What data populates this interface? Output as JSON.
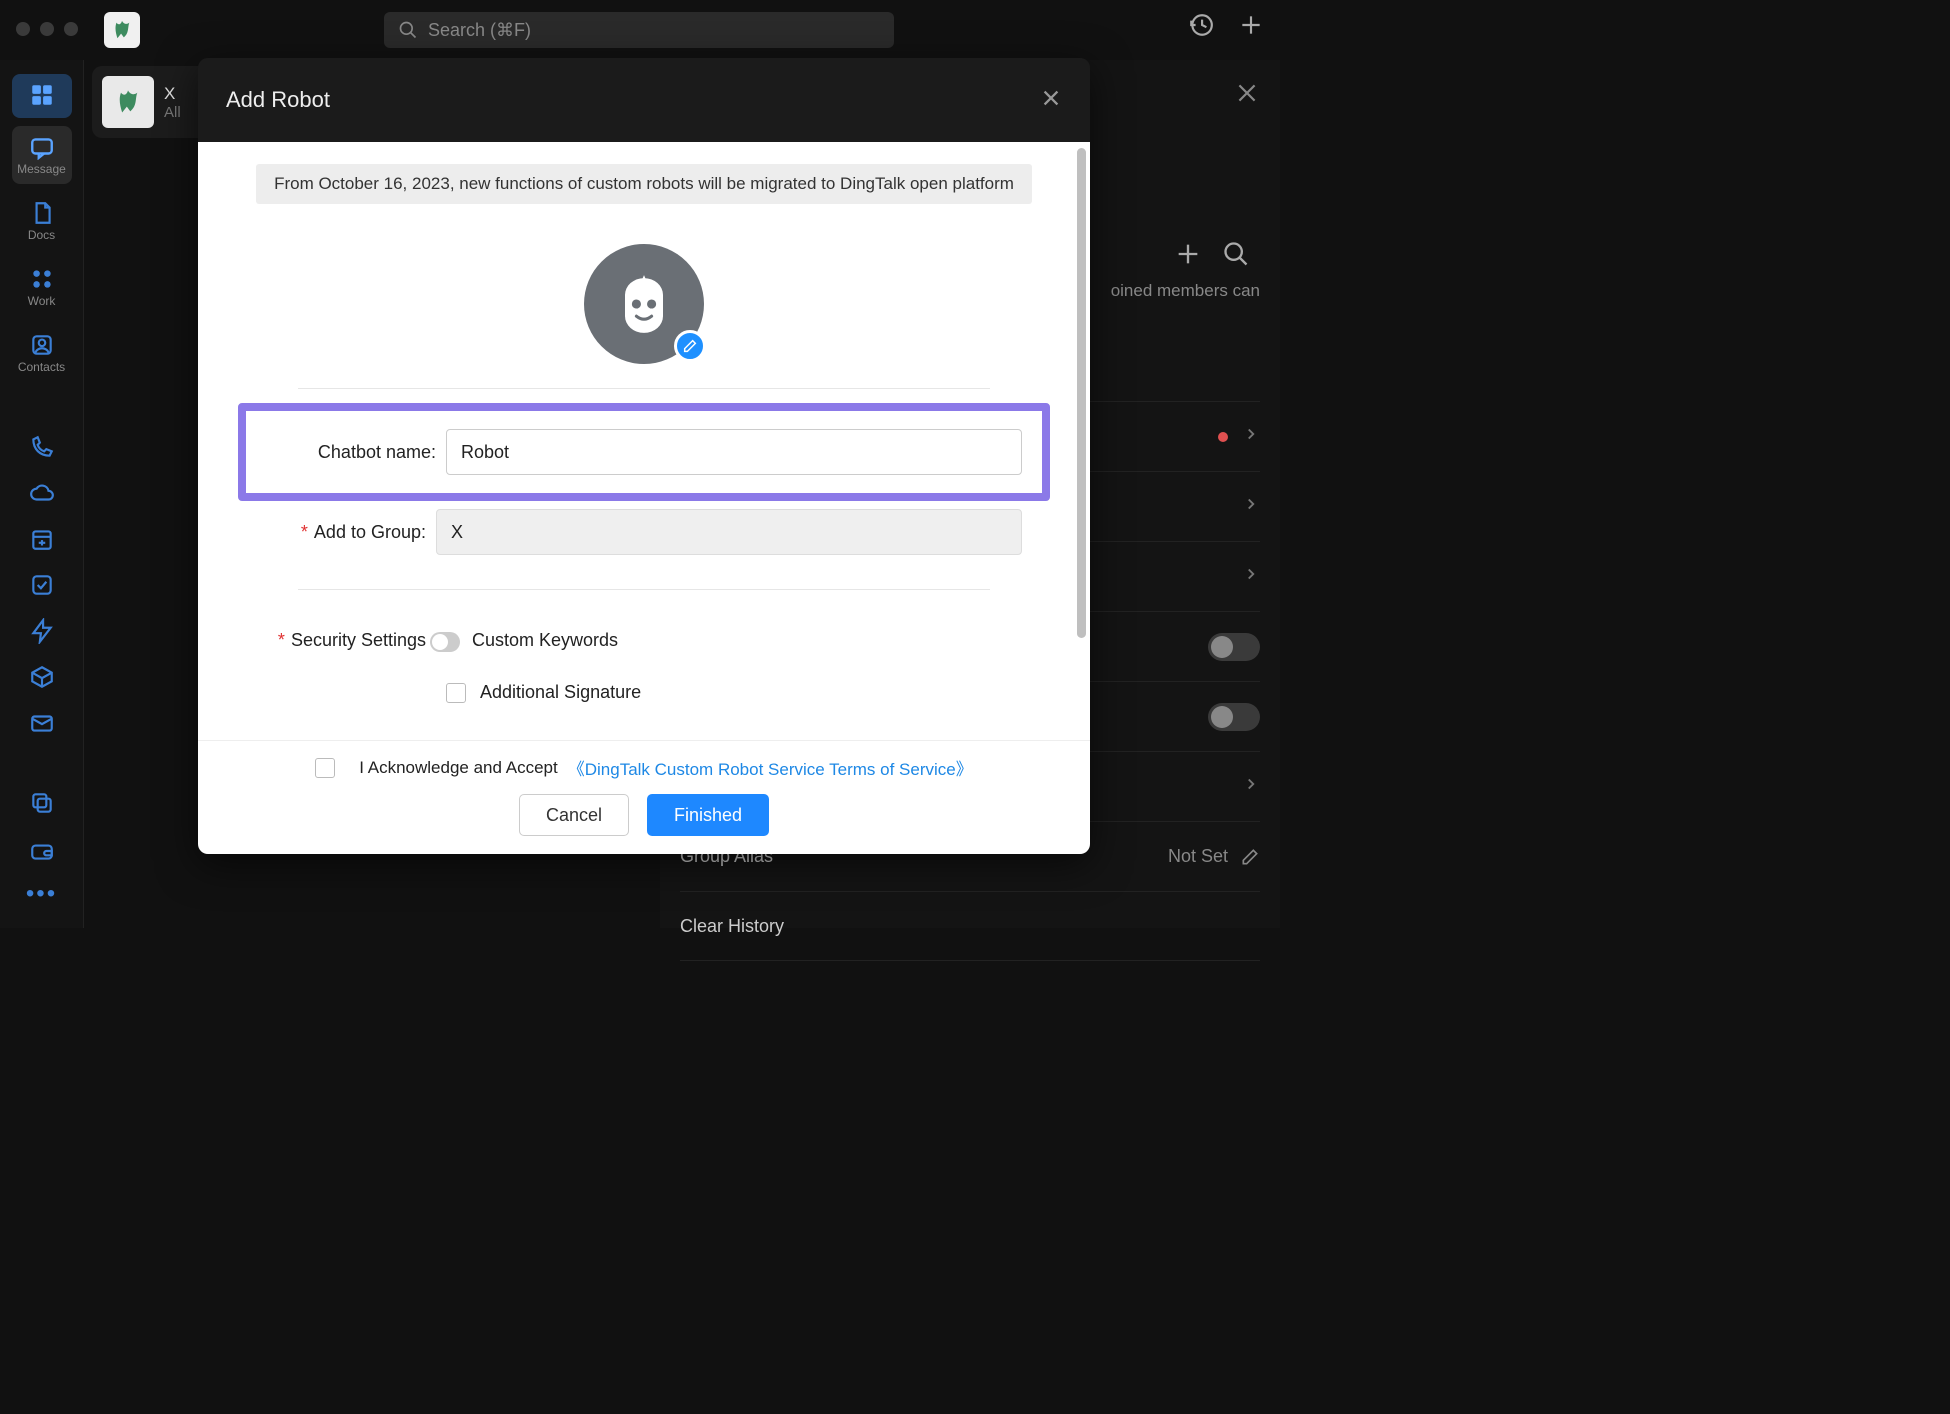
{
  "topbar": {
    "search_placeholder": "Search (⌘F)"
  },
  "sidebar": {
    "items": [
      {
        "label": ""
      },
      {
        "label": "Message"
      },
      {
        "label": "Docs"
      },
      {
        "label": "Work"
      },
      {
        "label": "Contacts"
      }
    ]
  },
  "chatlist": {
    "row": {
      "title": "X",
      "subtitle": "All"
    }
  },
  "rightpanel": {
    "hint": "oined members can",
    "group_alias_label": "Group Alias",
    "group_alias_value": "Not Set",
    "clear_history_label": "Clear History"
  },
  "modal": {
    "title": "Add Robot",
    "notice": "From October 16, 2023, new functions of custom robots will be migrated to DingTalk open platform",
    "chatbot_name_label": "Chatbot name:",
    "chatbot_name_value": "Robot",
    "add_group_label": "Add to Group:",
    "add_group_value": "X",
    "security_label": "Security Settings",
    "opt_keywords": "Custom Keywords",
    "opt_signature": "Additional Signature",
    "ack_text": "I Acknowledge and Accept",
    "tos_text": "《DingTalk Custom Robot Service Terms of Service》",
    "cancel": "Cancel",
    "finished": "Finished"
  }
}
